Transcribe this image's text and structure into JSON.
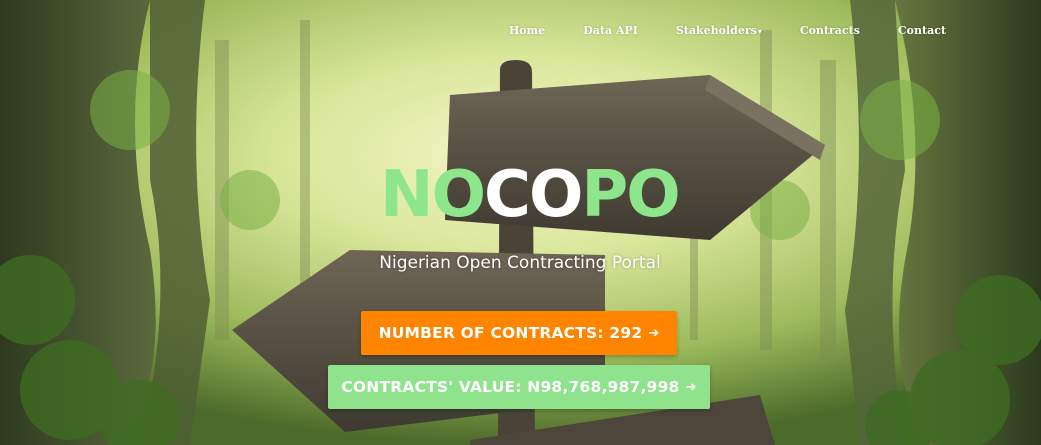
{
  "nav": {
    "items": [
      {
        "label": "Home",
        "name": "nav-home"
      },
      {
        "label": "Data API",
        "name": "nav-data-api"
      },
      {
        "label": "Stakeholders",
        "name": "nav-stakeholders",
        "dropdown": true
      },
      {
        "label": "Contracts",
        "name": "nav-contracts"
      },
      {
        "label": "Contact",
        "name": "nav-contact"
      }
    ],
    "caret_icon": "caret-down-icon"
  },
  "hero": {
    "logo_part1": "NO",
    "logo_part2": "CO",
    "logo_part3": "PO",
    "tagline": "Nigerian Open Contracting Portal",
    "count_button": "NUMBER OF CONTRACTS: 292",
    "value_button": "CONTRACTS' VALUE: N98,768,987,998",
    "arrow_icon": "arrow-right-icon"
  },
  "colors": {
    "logo_green": "#8ee68c",
    "logo_white": "#ffffff",
    "count_button_bg": "#ff8400",
    "value_button_bg": "#8fe38d"
  }
}
